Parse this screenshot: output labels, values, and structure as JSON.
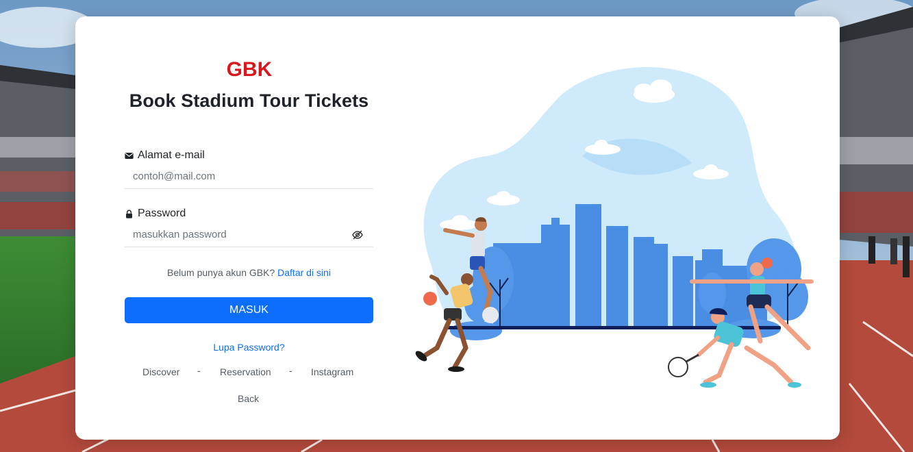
{
  "brand": {
    "logo_text": "GBK",
    "logo_color": "#d7191f"
  },
  "page": {
    "title": "Book Stadium Tour Tickets"
  },
  "email": {
    "label": "Alamat e-mail",
    "placeholder": "contoh@mail.com",
    "icon": "envelope-icon"
  },
  "password": {
    "label": "Password",
    "placeholder": "masukkan password",
    "icon": "lock-icon",
    "toggle_icon": "eye-slash-icon"
  },
  "register": {
    "prompt": "Belum punya akun GBK?",
    "link": "Daftar di sini"
  },
  "submit": {
    "label": "MASUK",
    "color": "#0d6efd"
  },
  "forgot": {
    "label": "Lupa Password?"
  },
  "footer": {
    "links": [
      "Discover",
      "Reservation",
      "Instagram"
    ],
    "separator": "-",
    "back": "Back"
  },
  "illustration": {
    "icon": "sports-city-illustration"
  },
  "colors": {
    "accent": "#0d6efd",
    "card": "#ffffff",
    "sky": "#cfeafb",
    "city": "#4a8ee4"
  }
}
